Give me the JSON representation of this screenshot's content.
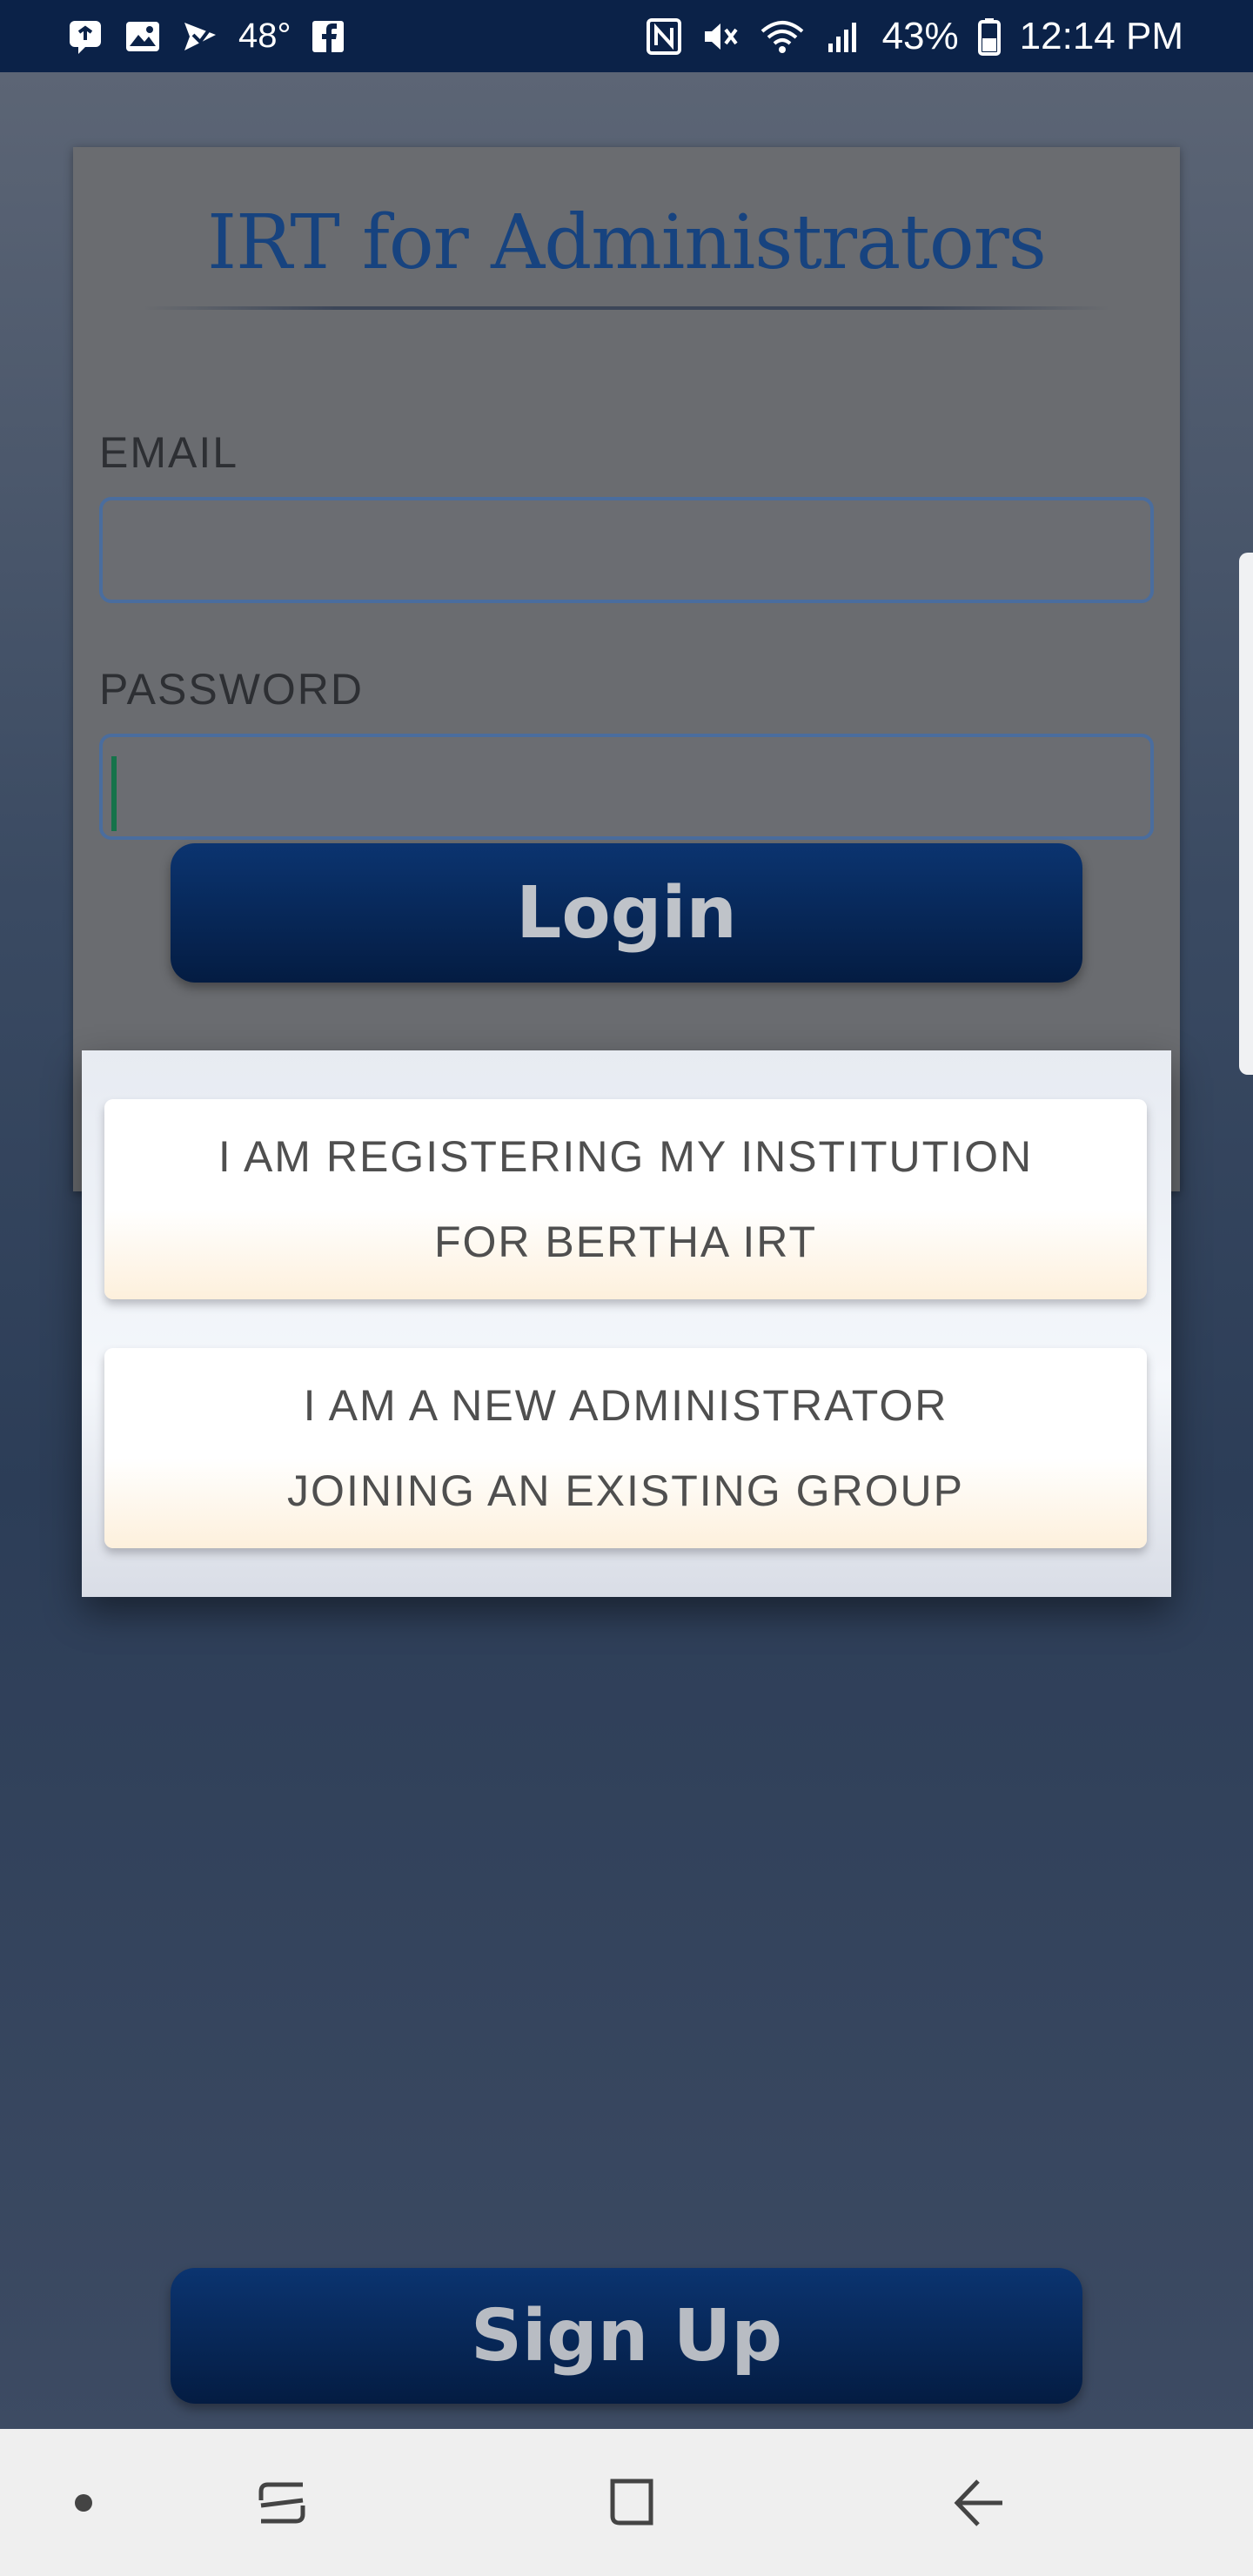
{
  "status_bar": {
    "temperature": "48°",
    "battery": "43%",
    "time": "12:14 PM",
    "icons_left": [
      "messenger-icon",
      "gallery-icon",
      "sent-icon",
      "facebook-icon"
    ],
    "icons_right": [
      "nfc-icon",
      "mute-icon",
      "wifi-icon",
      "signal-icon",
      "battery-icon"
    ]
  },
  "login_card": {
    "title": "IRT for Administrators",
    "email_label": "EMAIL",
    "email_value": "",
    "password_label": "PASSWORD",
    "password_value": "",
    "login_button": "Login"
  },
  "dialog": {
    "options": [
      {
        "line1": "I AM REGISTERING MY INSTITUTION",
        "line2": "FOR BERTHA IRT"
      },
      {
        "line1": "I AM A NEW ADMINISTRATOR",
        "line2": "JOINING AN EXISTING GROUP"
      }
    ]
  },
  "signup_button": "Sign Up",
  "nav_bar": {
    "items": [
      "dot-icon",
      "recents-icon",
      "home-icon",
      "back-icon"
    ]
  },
  "colors": {
    "status_bar": "#0b2248",
    "title": "#17437f",
    "button": "#0b3470",
    "dialog_bg": "#eef1f6",
    "option_bottom": "#fdf0dc"
  }
}
